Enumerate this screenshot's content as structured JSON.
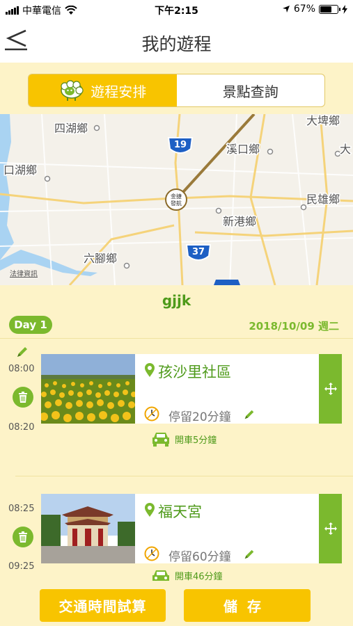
{
  "status_bar": {
    "carrier": "中華電信",
    "time": "下午2:15",
    "battery": "67%",
    "battery_level": 0.67
  },
  "nav": {
    "back_icon": "back-chevron-icon",
    "title": "我的遊程"
  },
  "segments": [
    {
      "label": "遊程安排",
      "active": true,
      "icon": "sheep-logo-icon"
    },
    {
      "label": "景點查詢",
      "active": false
    }
  ],
  "map": {
    "labels": {
      "sihu": "四湖鄉",
      "dapi": "大埤鄉",
      "xikou": "溪口鄉",
      "da": "大",
      "kouhu": "口湖鄉",
      "minxiong": "民雄鄉",
      "xingang": "新港鄉",
      "liujiao": "六腳鄉",
      "jinjie": "金捷",
      "faxing": "發航",
      "legal": "法律資訊"
    },
    "roads": {
      "r19": "19",
      "r37": "37"
    }
  },
  "trip": {
    "name": "gjjk",
    "day_label": "Day 1",
    "date": "2018/10/09 週二"
  },
  "stops": [
    {
      "start": "08:00",
      "end": "08:20",
      "name": "孩沙里社區",
      "stay": "停留20分鐘",
      "drive": "開車5分鐘",
      "photo": "sunflower-field"
    },
    {
      "start": "08:25",
      "end": "09:25",
      "name": "福天宮",
      "stay": "停留60分鐘",
      "drive": "開車46分鐘",
      "photo": "temple"
    }
  ],
  "buttons": {
    "calc": "交通時間試算",
    "save": "儲存"
  },
  "colors": {
    "accent_yellow": "#f8c400",
    "accent_green": "#7bb92e",
    "text_green": "#4e9a1a",
    "background": "#fdf3c8"
  }
}
